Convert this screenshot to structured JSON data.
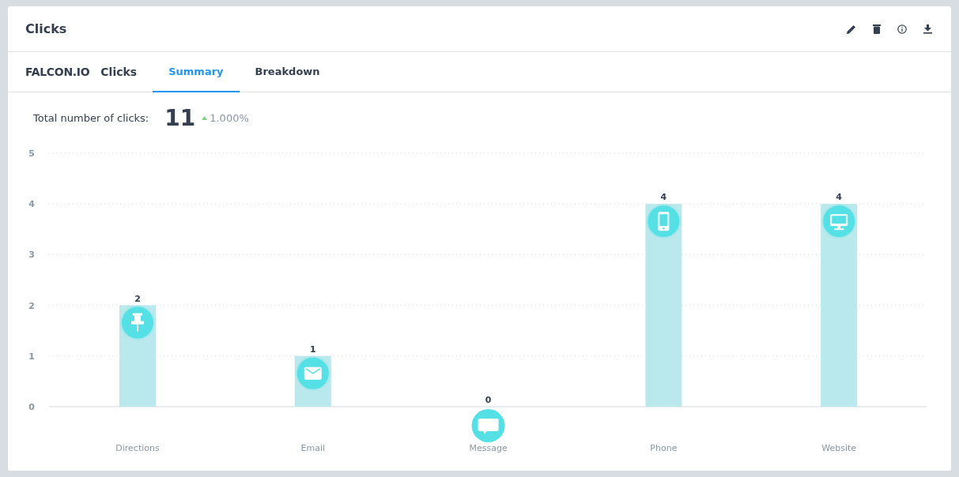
{
  "card": {
    "title": "Clicks"
  },
  "brand": "FALCON.IO",
  "section": "Clicks",
  "tabs": [
    {
      "label": "Summary",
      "selected": true
    },
    {
      "label": "Breakdown",
      "selected": false
    }
  ],
  "summary": {
    "label": "Total number of clicks:",
    "total": "11",
    "change": "1.000%"
  },
  "chart_data": {
    "type": "bar",
    "categories": [
      "Directions",
      "Email",
      "Message",
      "Phone",
      "Website"
    ],
    "series": [
      {
        "color": "#b9e9ec",
        "values": [
          2,
          1,
          0,
          4,
          4
        ]
      }
    ],
    "ylim": [
      0,
      5
    ],
    "yticks": [
      0,
      1,
      2,
      3,
      4,
      5
    ],
    "grid": true,
    "data_labels": true
  }
}
